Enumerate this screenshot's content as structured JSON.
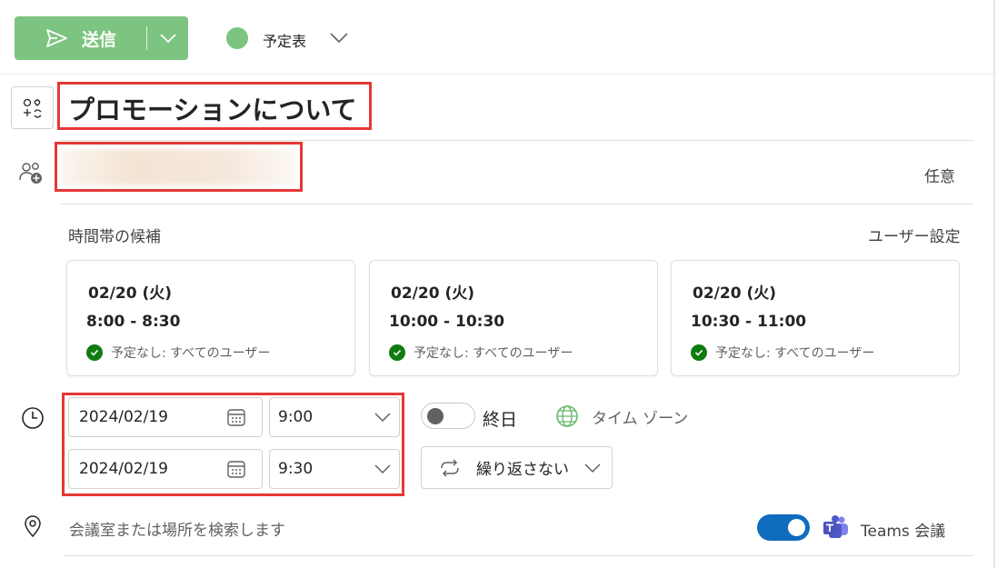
{
  "toolbar": {
    "send_label": "送信",
    "calendar_label": "予定表",
    "calendar_color": "#7cc47f"
  },
  "event": {
    "title": "プロモーションについて"
  },
  "attendees": {
    "optional_label": "任意"
  },
  "suggestions": {
    "title": "時間帯の候補",
    "settings_label": "ユーザー設定",
    "slots": [
      {
        "date": "02/20 (火)",
        "time": "8:00 - 8:30",
        "status": "予定なし: すべてのユーザー"
      },
      {
        "date": "02/20 (火)",
        "time": "10:00 - 10:30",
        "status": "予定なし: すべてのユーザー"
      },
      {
        "date": "02/20 (火)",
        "time": "10:30 - 11:00",
        "status": "予定なし: すべてのユーザー"
      }
    ]
  },
  "datetime": {
    "start_date": "2024/02/19",
    "start_time": "9:00",
    "end_date": "2024/02/19",
    "end_time": "9:30",
    "allday_label": "終日",
    "allday_on": false,
    "timezone_label": "タイム ゾーン",
    "repeat_label": "繰り返さない"
  },
  "location": {
    "placeholder": "会議室または場所を検索します",
    "teams_on": true,
    "teams_label": "Teams 会議"
  },
  "colors": {
    "accent": "#0f6cbd",
    "send": "#7cc47f",
    "highlight": "#e53935",
    "available": "#107c10"
  }
}
